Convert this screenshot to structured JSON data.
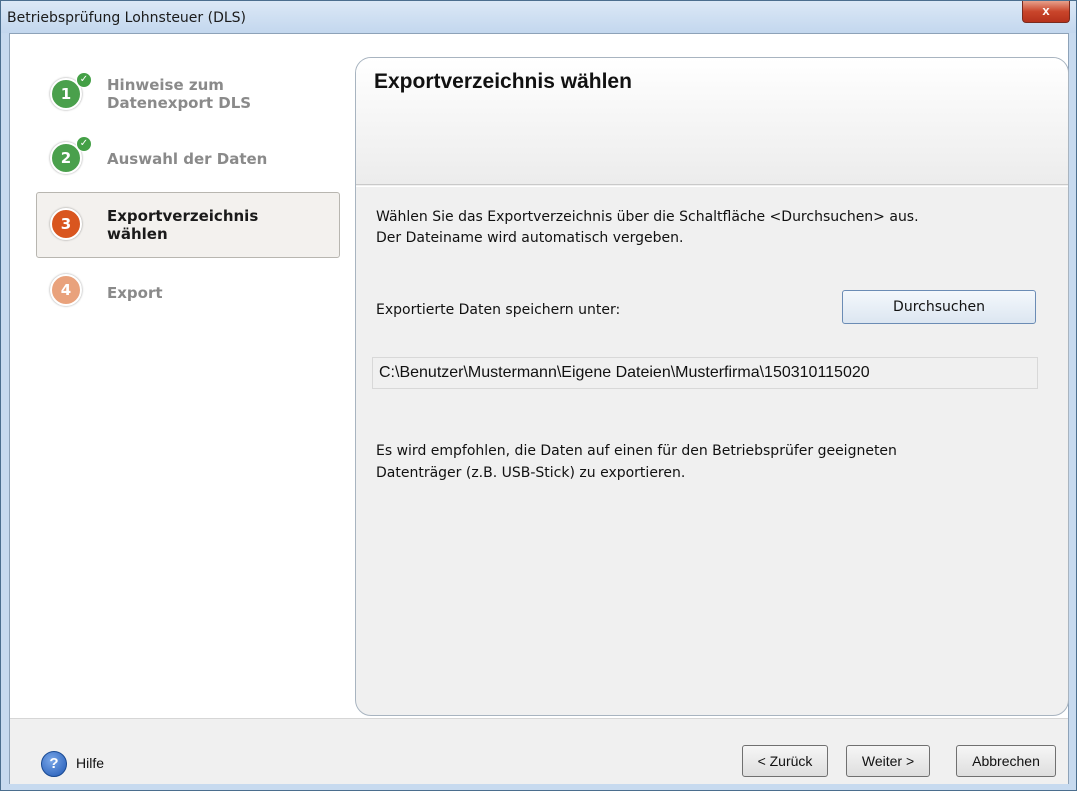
{
  "window": {
    "title": "Betriebsprüfung Lohnsteuer (DLS)",
    "close_label": "x"
  },
  "steps": [
    {
      "number": "1",
      "label_line1": "Hinweise zum",
      "label_line2": "Datenexport DLS",
      "state": "done",
      "color": "#4aa04c"
    },
    {
      "number": "2",
      "label_line1": "Auswahl der Daten",
      "label_line2": "",
      "state": "done",
      "color": "#4aa04c"
    },
    {
      "number": "3",
      "label_line1": "Exportverzeichnis",
      "label_line2": "wählen",
      "state": "active",
      "color": "#d9561f"
    },
    {
      "number": "4",
      "label_line1": "Export",
      "label_line2": "",
      "state": "pending",
      "color": "#e9a27c"
    }
  ],
  "check_glyph": "✓",
  "panel": {
    "title": "Exportverzeichnis wählen",
    "intro_line1": "Wählen Sie das Exportverzeichnis über die Schaltfläche <Durchsuchen> aus.",
    "intro_line2": "Der Dateiname wird automatisch vergeben.",
    "save_label": "Exportierte Daten speichern unter:",
    "browse_button": "Durchsuchen",
    "path_value": "C:\\Benutzer\\Mustermann\\Eigene Dateien\\Musterfirma\\150310115020",
    "hint_line1": "Es wird empfohlen, die Daten auf einen für den Betriebsprüfer geeigneten",
    "hint_line2": "Datenträger (z.B. USB-Stick) zu exportieren."
  },
  "footer": {
    "help_icon_glyph": "?",
    "help_label": "Hilfe",
    "back_button": "< Zurück",
    "next_button": "Weiter >",
    "cancel_button": "Abbrechen"
  },
  "colors": {
    "text_muted": "#8a8a8a",
    "text_active": "#1a1a1a",
    "accent_done": "#4aa04c",
    "accent_active": "#d9561f"
  }
}
